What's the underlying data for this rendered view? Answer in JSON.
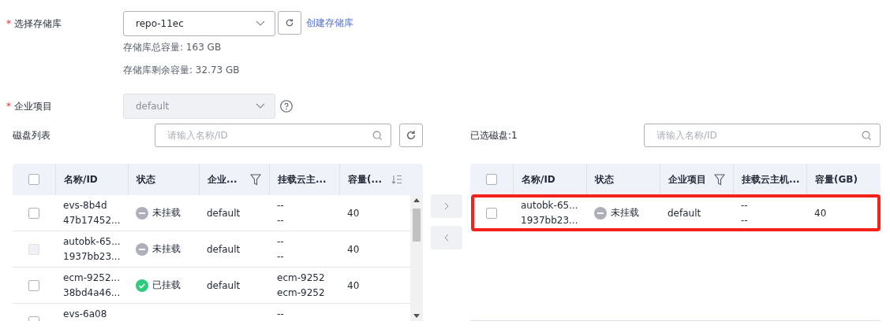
{
  "repo": {
    "label": "选择存储库",
    "required_mark": "*",
    "value": "repo-11ec",
    "create_link": "创建存储库",
    "total": "存储库总容量: 163 GB",
    "remaining": "存储库剩余容量: 32.73 GB"
  },
  "enterprise": {
    "label": "企业项目",
    "required_mark": "*",
    "value": "default",
    "disabled": true
  },
  "disk_list": {
    "label": "磁盘列表",
    "search_placeholder": "请输入名称/ID",
    "select_all_checked": false,
    "columns": [
      {
        "label": "名称/ID",
        "kind": "text"
      },
      {
        "label": "状态",
        "kind": "text"
      },
      {
        "label": "企业...",
        "kind": "filter"
      },
      {
        "label": "挂载云主...",
        "kind": "text"
      },
      {
        "label": "容量(...",
        "kind": "sort"
      }
    ],
    "rows": [
      {
        "name": "evs-8b4d",
        "id": "47b17452...",
        "kind": "unmounted",
        "status_label": "未挂载",
        "project": "default",
        "mount": [
          "--",
          "--"
        ],
        "capacity": "40",
        "checked": false,
        "disabled": false
      },
      {
        "name": "autobk-65...",
        "id": "1937bb23...",
        "kind": "unmounted",
        "status_label": "未挂载",
        "project": "default",
        "mount": [
          "--",
          "--"
        ],
        "capacity": "40",
        "checked": false,
        "disabled": true
      },
      {
        "name": "ecm-9252...",
        "id": "38bd4a46...",
        "kind": "mounted",
        "status_label": "已挂载",
        "project": "default",
        "mount": [
          "ecm-9252",
          "ecm-9252"
        ],
        "capacity": "40",
        "checked": false,
        "disabled": false
      },
      {
        "name": "evs-6a08",
        "mount": [
          "--"
        ],
        "checked": false,
        "disabled": false
      }
    ]
  },
  "transfer": {
    "right_disabled": false,
    "left_disabled": false
  },
  "selected": {
    "label": "已选磁盘:1",
    "search_placeholder": "请输入名称/ID",
    "select_all_checked": false,
    "columns": [
      {
        "label": "名称/ID",
        "kind": "text"
      },
      {
        "label": "状态",
        "kind": "text"
      },
      {
        "label": "企业项目",
        "kind": "filter"
      },
      {
        "label": "挂载云主机...",
        "kind": "text"
      },
      {
        "label": "容量(GB)",
        "kind": "text"
      }
    ],
    "rows": [
      {
        "name": "autobk-65...",
        "id": "1937bb23...",
        "kind": "unmounted",
        "status_label": "未挂载",
        "project": "default",
        "mount": [
          "--",
          "--"
        ],
        "capacity": "40",
        "checked": false,
        "disabled": false,
        "highlighted": true
      }
    ]
  }
}
